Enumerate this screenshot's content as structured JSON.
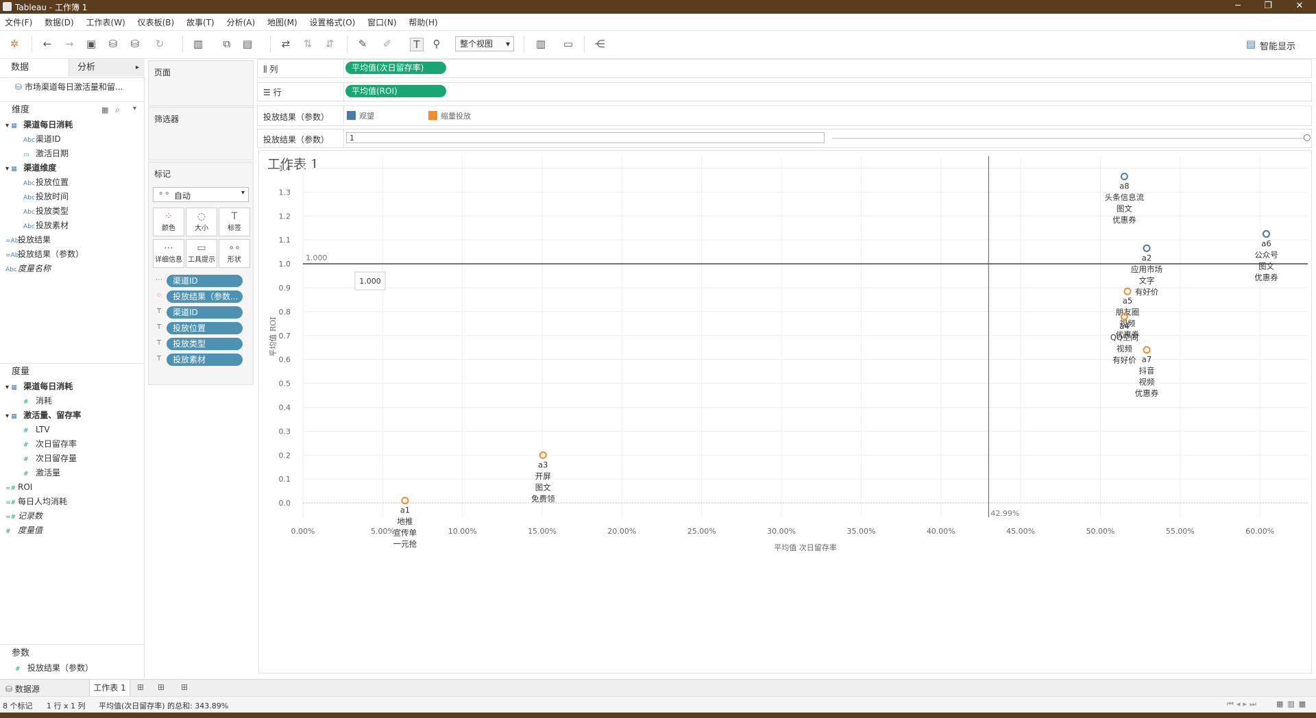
{
  "window": {
    "title": "Tableau - 工作簿 1"
  },
  "menu": [
    "文件(F)",
    "数据(D)",
    "工作表(W)",
    "仪表板(B)",
    "故事(T)",
    "分析(A)",
    "地图(M)",
    "设置格式(O)",
    "窗口(N)",
    "帮助(H)"
  ],
  "toolbar": {
    "fit_label": "整个视图",
    "show_me_label": "智能显示"
  },
  "left": {
    "tab_data": "数据",
    "tab_analysis": "分析",
    "datasource": "市场渠道每日激活量和留...",
    "dimensions_header": "维度",
    "dimension_items": [
      {
        "label": "渠道每日消耗",
        "type": "table",
        "level": 0
      },
      {
        "label": "渠道ID",
        "type": "Abc",
        "level": 1
      },
      {
        "label": "激活日期",
        "type": "date",
        "level": 1
      },
      {
        "label": "渠道维度",
        "type": "table",
        "level": 0
      },
      {
        "label": "投放位置",
        "type": "Abc",
        "level": 1
      },
      {
        "label": "投放时间",
        "type": "Abc",
        "level": 1
      },
      {
        "label": "投放类型",
        "type": "Abc",
        "level": 1
      },
      {
        "label": "投放素材",
        "type": "Abc",
        "level": 1
      },
      {
        "label": "投放结果",
        "type": "=Abc",
        "level": 0
      },
      {
        "label": "投放结果（参数）",
        "type": "=Abc",
        "level": 0
      },
      {
        "label": "度量名称",
        "type": "Abc",
        "level": 0,
        "italic": true
      }
    ],
    "measures_header": "度量",
    "measure_items": [
      {
        "label": "渠道每日消耗",
        "type": "table",
        "level": 0
      },
      {
        "label": "消耗",
        "type": "#",
        "level": 1
      },
      {
        "label": "激活量、留存率",
        "type": "table",
        "level": 0
      },
      {
        "label": "LTV",
        "type": "#",
        "level": 1
      },
      {
        "label": "次日留存率",
        "type": "#",
        "level": 1
      },
      {
        "label": "次日留存量",
        "type": "#",
        "level": 1
      },
      {
        "label": "激活量",
        "type": "#",
        "level": 1
      },
      {
        "label": "ROI",
        "type": "=#",
        "level": 0
      },
      {
        "label": "每日人均消耗",
        "type": "=#",
        "level": 0
      },
      {
        "label": "记录数",
        "type": "=#",
        "level": 0,
        "italic": true
      },
      {
        "label": "度量值",
        "type": "#",
        "level": 0,
        "italic": true
      }
    ],
    "params_header": "参数",
    "param_items": [
      {
        "label": "投放结果（参数）",
        "type": "#"
      }
    ]
  },
  "pages_label": "页面",
  "filters_label": "筛选器",
  "marks": {
    "title": "标记",
    "type_label": "自动",
    "buttons": [
      {
        "label": "颜色",
        "icon": "color-icon"
      },
      {
        "label": "大小",
        "icon": "size-icon"
      },
      {
        "label": "标签",
        "icon": "label-icon"
      },
      {
        "label": "详细信息",
        "icon": "detail-icon"
      },
      {
        "label": "工具提示",
        "icon": "tooltip-icon"
      },
      {
        "label": "形状",
        "icon": "shape-icon"
      }
    ],
    "pills": [
      {
        "label": "渠道ID",
        "icon": "detail-icon"
      },
      {
        "label": "投放结果（参数...",
        "icon": "color-icon"
      },
      {
        "label": "渠道ID",
        "icon": "label-icon"
      },
      {
        "label": "投放位置",
        "icon": "label-icon"
      },
      {
        "label": "投放类型",
        "icon": "label-icon"
      },
      {
        "label": "投放素材",
        "icon": "label-icon"
      }
    ]
  },
  "shelves": {
    "columns_label": "列",
    "columns_pill": "平均值(次日留存率)",
    "rows_label": "行",
    "rows_pill": "平均值(ROI)",
    "legend_label": "投放结果（参数）",
    "legend_items": [
      {
        "label": "观望",
        "color": "#4e79a7"
      },
      {
        "label": "缩量投放",
        "color": "#f28e2b"
      }
    ],
    "param_label": "投放结果（参数）",
    "param_value": "1"
  },
  "sheet_title": "工作表 1",
  "chart_data": {
    "type": "scatter",
    "title": "工作表 1",
    "xlabel": "平均值 次日留存率",
    "ylabel": "平均值 ROI",
    "xlim": [
      0,
      0.63
    ],
    "ylim": [
      -0.06,
      1.45
    ],
    "x_ticks": [
      "0.00%",
      "5.00%",
      "10.00%",
      "15.00%",
      "20.00%",
      "25.00%",
      "30.00%",
      "35.00%",
      "40.00%",
      "45.00%",
      "50.00%",
      "55.00%",
      "60.00%"
    ],
    "y_ticks": [
      "0.0",
      "0.1",
      "0.2",
      "0.3",
      "0.4",
      "0.5",
      "0.6",
      "0.7",
      "0.8",
      "0.9",
      "1.0",
      "1.1",
      "1.2",
      "1.3",
      "1.4"
    ],
    "ref_line_y": {
      "value": 1.0,
      "label": "1.000"
    },
    "ref_line_x": {
      "value": 0.4299,
      "label": "42.99%"
    },
    "tooltip_text": "1.000",
    "points": [
      {
        "x": 0.515,
        "y": 1.365,
        "color": "#4e79a7",
        "label": [
          "a8",
          "头条信息流",
          "图文",
          "优惠券"
        ]
      },
      {
        "x": 0.604,
        "y": 1.125,
        "color": "#4e79a7",
        "label": [
          "a6",
          "公众号",
          "图文",
          "优惠券"
        ]
      },
      {
        "x": 0.529,
        "y": 1.065,
        "color": "#4e79a7",
        "label": [
          "a2",
          "应用市场",
          "文字",
          "有好价"
        ]
      },
      {
        "x": 0.517,
        "y": 0.885,
        "color": "#f28e2b",
        "label": [
          "a5",
          "朋友圈",
          "视频",
          "优惠券"
        ]
      },
      {
        "x": 0.515,
        "y": 0.78,
        "color": "#f28e2b",
        "label": [
          "a4",
          "QQ空间",
          "视频",
          "有好价"
        ]
      },
      {
        "x": 0.529,
        "y": 0.64,
        "color": "#f28e2b",
        "label": [
          "a7",
          "抖音",
          "视频",
          "优惠券"
        ]
      },
      {
        "x": 0.1505,
        "y": 0.2,
        "color": "#f28e2b",
        "label": [
          "a3",
          "开屏",
          "图文",
          "免费领"
        ]
      },
      {
        "x": 0.064,
        "y": 0.01,
        "color": "#f28e2b",
        "label": [
          "a1",
          "地推",
          "宣传单",
          "一元抢"
        ]
      }
    ]
  },
  "bottom": {
    "datasource_tab": "数据源",
    "sheet_tab": "工作表 1"
  },
  "status": {
    "marks": "8 个标记",
    "rows_cols": "1 行 x 1 列",
    "sum": "平均值(次日留存率) 的总和: 343.89%"
  }
}
